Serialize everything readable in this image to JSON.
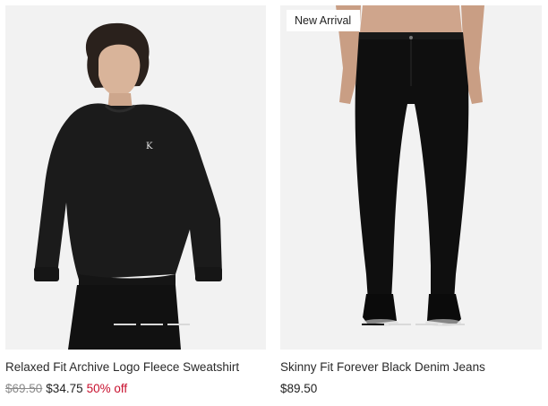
{
  "products": [
    {
      "title": "Relaxed Fit Archive Logo Fleece Sweatshirt",
      "original_price": "$69.50",
      "sale_price": "$34.75",
      "discount": "50% off",
      "badge": "",
      "image": "model-black-crewneck-sweatshirt",
      "image_count": 4,
      "active_image": 1
    },
    {
      "title": "Skinny Fit Forever Black Denim Jeans",
      "price": "$89.50",
      "badge": "New Arrival",
      "image": "model-black-skinny-jeans",
      "image_count": 4,
      "active_image": 1
    }
  ],
  "colors": {
    "image_background": "#f2f2f2",
    "discount": "#c8102e",
    "strikethrough": "#8a8a8a",
    "active_dot": "#111111",
    "inactive_dot": "#d9d9d9"
  }
}
